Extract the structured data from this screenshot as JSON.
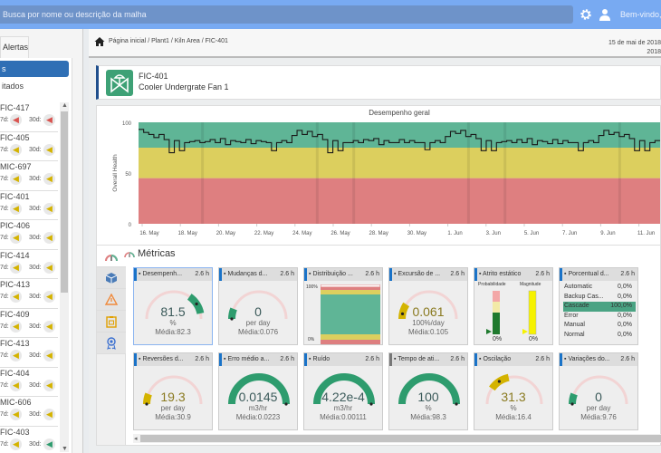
{
  "topbar": {
    "search_placeholder": "Busca por nome ou descrição da malha",
    "welcome": "Bem-vindo, ...",
    "icons": [
      "gear-icon",
      "user-icon"
    ]
  },
  "left": {
    "tab_label": "Alertas",
    "selected_button": "s",
    "favorites_label": "itados",
    "items": [
      {
        "name": "FIC-417",
        "d7_label": "7d:",
        "d30_label": "30d:",
        "d7_color": "#d9534f",
        "d30_color": "#d9534f"
      },
      {
        "name": "FIC-405",
        "d7_label": "7d:",
        "d30_label": "30d:",
        "d7_color": "#d4b300",
        "d30_color": "#d4b300"
      },
      {
        "name": "MIC-697",
        "d7_label": "7d:",
        "d30_label": "30d:",
        "d7_color": "#d4b300",
        "d30_color": "#d4b300"
      },
      {
        "name": "FIC-401",
        "d7_label": "7d:",
        "d30_label": "30d:",
        "d7_color": "#d4b300",
        "d30_color": "#d4b300"
      },
      {
        "name": "PIC-406",
        "d7_label": "7d:",
        "d30_label": "30d:",
        "d7_color": "#d4b300",
        "d30_color": "#d4b300"
      },
      {
        "name": "FIC-414",
        "d7_label": "7d:",
        "d30_label": "30d:",
        "d7_color": "#d4b300",
        "d30_color": "#d4b300"
      },
      {
        "name": "PIC-413",
        "d7_label": "7d:",
        "d30_label": "30d:",
        "d7_color": "#d4b300",
        "d30_color": "#d4b300"
      },
      {
        "name": "FIC-409",
        "d7_label": "7d:",
        "d30_label": "30d:",
        "d7_color": "#d4b300",
        "d30_color": "#d4b300"
      },
      {
        "name": "FIC-413",
        "d7_label": "7d:",
        "d30_label": "30d:",
        "d7_color": "#d4b300",
        "d30_color": "#d4b300"
      },
      {
        "name": "FIC-404",
        "d7_label": "7d:",
        "d30_label": "30d:",
        "d7_color": "#d4b300",
        "d30_color": "#d4b300"
      },
      {
        "name": "MIC-606",
        "d7_label": "7d:",
        "d30_label": "30d:",
        "d7_color": "#d4b300",
        "d30_color": "#d4b300"
      },
      {
        "name": "FIC-403",
        "d7_label": "7d:",
        "d30_label": "30d:",
        "d7_color": "#d4b300",
        "d30_color": "#2e9c6e"
      }
    ]
  },
  "main": {
    "breadcrumb": "Página inicial / Plant1 / Kiln Area / FIC-401",
    "date_line1": "15 de mai de 2018",
    "date_line2": "2018",
    "loop": {
      "tag": "FIC-401",
      "description": "Cooler Undergrate Fan 1"
    },
    "metrics_title": "Métricas",
    "side_tabs": [
      "gauge-icon",
      "cube-icon",
      "warning-icon",
      "clipboard-icon",
      "award-icon"
    ]
  },
  "chart_data": {
    "type": "line",
    "title": "Desempenho geral",
    "ylabel": "Overall Health",
    "xlabel": "",
    "ylim": [
      0,
      100
    ],
    "yticks": [
      "0",
      "50",
      "100"
    ],
    "xticks": [
      "16. May",
      "18. May",
      "20. May",
      "22. May",
      "24. May",
      "26. May",
      "28. May",
      "30. May",
      "1. Jun",
      "3. Jun",
      "5. Jun",
      "7. Jun",
      "9. Jun",
      "11. Jun"
    ],
    "bands": [
      {
        "from": 0,
        "to": 45,
        "color": "#de7f80"
      },
      {
        "from": 45,
        "to": 75,
        "color": "#dccf5e"
      },
      {
        "from": 75,
        "to": 100,
        "color": "#5fb596"
      }
    ],
    "series": [
      {
        "name": "Overall Health",
        "values": [
          93,
          90,
          88,
          85,
          88,
          83,
          70,
          82,
          72,
          80,
          81,
          82,
          80,
          81,
          83,
          80,
          84,
          78,
          82,
          81,
          80,
          83,
          79,
          82,
          81,
          80,
          72,
          80,
          82,
          80,
          87,
          92,
          88,
          91,
          86,
          88,
          83,
          70,
          82,
          72,
          80,
          80,
          82,
          80,
          83,
          82,
          84,
          78,
          82,
          80,
          80,
          83,
          80,
          82,
          80,
          80,
          73,
          80,
          82,
          80,
          86,
          91,
          89,
          92,
          86,
          88,
          84,
          72,
          82,
          72,
          80,
          81,
          82,
          80,
          83,
          80,
          84,
          78,
          82,
          81,
          79,
          83,
          79,
          82,
          80,
          80,
          72,
          80,
          82,
          80,
          87,
          92,
          88,
          90,
          86,
          88,
          84,
          72,
          82,
          72,
          80,
          82
        ]
      }
    ]
  },
  "metrics": [
    {
      "title": "Desempenh...",
      "age": "2.6 h",
      "value": "81.5",
      "unit": "%",
      "avg": "Média:82.3",
      "icon": "heart-icon",
      "gauge": "arc",
      "fraction": 0.815,
      "color": "#2e9c6e"
    },
    {
      "title": "Mudanças d...",
      "age": "2.6 h",
      "value": "0",
      "unit": "per day",
      "avg": "Média:0.076",
      "icon": "changes-icon",
      "gauge": "arc",
      "fraction": 0.0,
      "color": "#2e9c6e"
    },
    {
      "title": "Distribuição ...",
      "age": "2.6 h",
      "icon": "distribution-icon",
      "gauge": "distribution",
      "top_label": "100%",
      "bottom_label": "0%"
    },
    {
      "title": "Excursão de ...",
      "age": "2.6 h",
      "value": "0.061",
      "unit": "100%/day",
      "avg": "Média:0.105",
      "icon": "briefcase-icon",
      "gauge": "arc",
      "fraction": 0.06,
      "color": "#d4b300"
    },
    {
      "title": "Atrito estático",
      "age": "2.6 h",
      "icon": "friction-icon",
      "gauge": "bars",
      "bar1_label": "Probabilidade",
      "bar2_label": "Magnitude",
      "bar1_value": "0%",
      "bar2_value": "0%"
    },
    {
      "title": "Porcentual d...",
      "age": "2.6 h",
      "icon": "percent-icon",
      "gauge": "table",
      "rows": [
        {
          "mode": "Automatic",
          "pct": "0,0%"
        },
        {
          "mode": "Backup Cas...",
          "pct": "0,0%"
        },
        {
          "mode": "Cascade",
          "pct": "100,0%",
          "highlight": true
        },
        {
          "mode": "Error",
          "pct": "0,0%"
        },
        {
          "mode": "Manual",
          "pct": "0,0%"
        },
        {
          "mode": "Normal",
          "pct": "0,0%"
        }
      ]
    },
    {
      "title": "Reversões d...",
      "age": "2.6 h",
      "value": "19.3",
      "unit": "per day",
      "avg": "Média:30.9",
      "icon": "reversal-icon",
      "gauge": "arc",
      "fraction": 0.0,
      "color": "#d4b300"
    },
    {
      "title": "Erro médio a...",
      "age": "2.6 h",
      "value": "0.0145",
      "unit": "m3/hr",
      "avg": "Média:0.0223",
      "icon": "error-icon",
      "gauge": "arc",
      "fraction": 1.0,
      "color": "#2e9c6e"
    },
    {
      "title": "Ruído",
      "age": "2.6 h",
      "value": "4.22e-4",
      "unit": "m3/hr",
      "avg": "Média:0.00111",
      "icon": "noise-icon",
      "gauge": "arc",
      "fraction": 1.0,
      "color": "#2e9c6e"
    },
    {
      "title": "Tempo de ati...",
      "age": "2.6 h",
      "value": "100",
      "unit": "%",
      "avg": "Média:98.3",
      "icon": "timer-icon",
      "gauge": "arc",
      "fraction": 1.0,
      "color": "#2e9c6e"
    },
    {
      "title": "Oscilação",
      "age": "2.6 h",
      "value": "31.3",
      "unit": "%",
      "avg": "Média:16.4",
      "icon": "oscillation-icon",
      "gauge": "arc",
      "fraction": 0.313,
      "color": "#d4b300"
    },
    {
      "title": "Variações do...",
      "age": "2.6 h",
      "value": "0",
      "unit": "per day",
      "avg": "Média:9.76",
      "icon": "variations-icon",
      "gauge": "arc",
      "fraction": 0.0,
      "color": "#2e9c6e"
    }
  ]
}
